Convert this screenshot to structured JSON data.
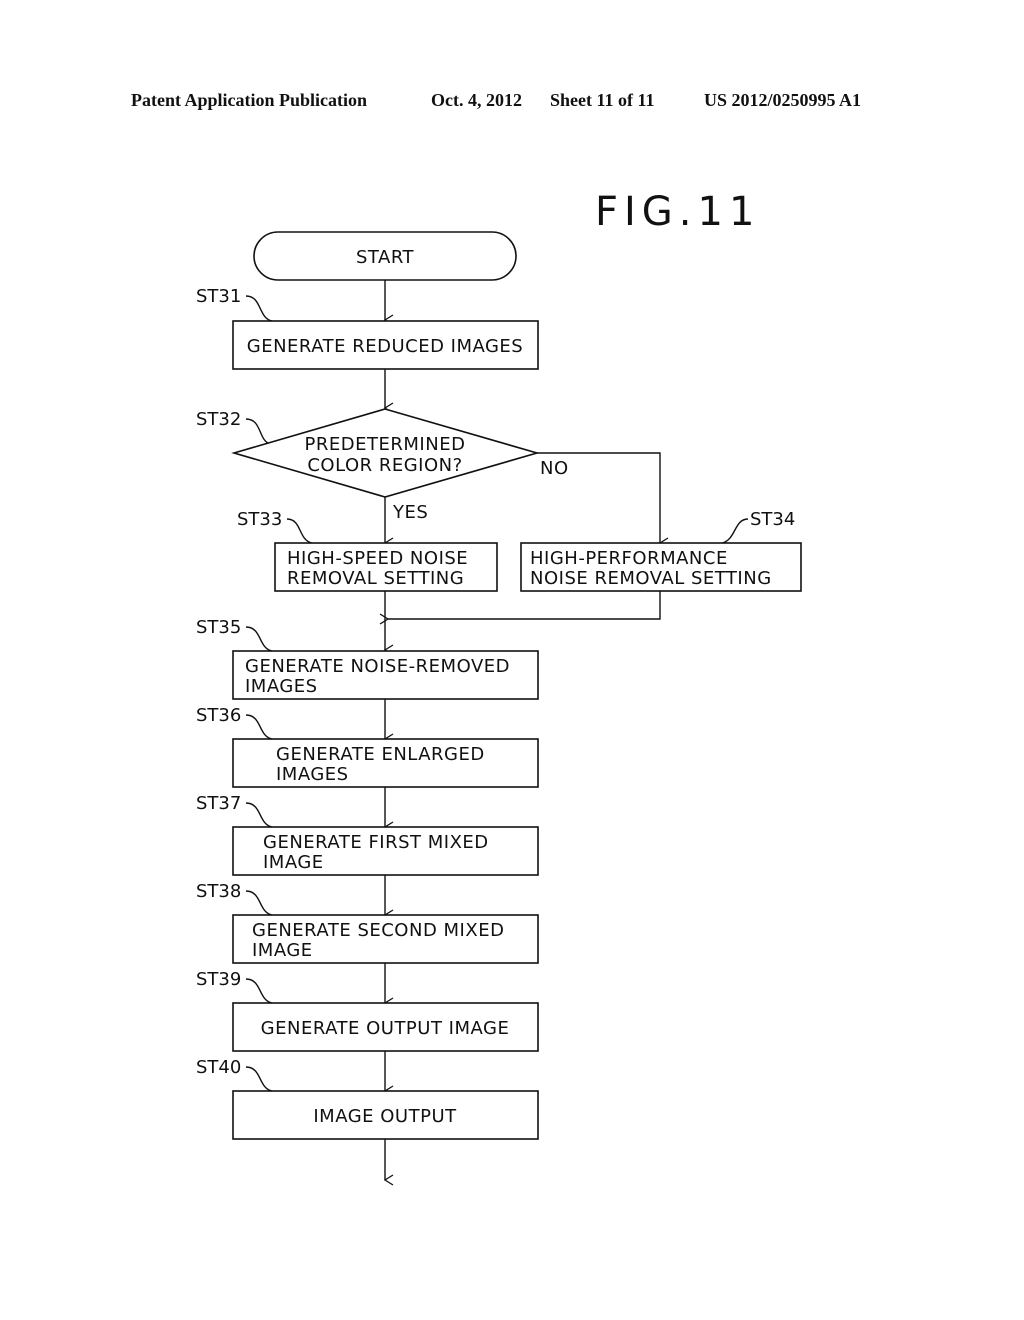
{
  "header": {
    "publication": "Patent Application Publication",
    "date": "Oct. 4, 2012",
    "sheet": "Sheet 11 of 11",
    "number": "US 2012/0250995 A1"
  },
  "figure": {
    "title": "FIG.11"
  },
  "flowchart": {
    "start": "START",
    "steps": {
      "st31": {
        "id": "ST31",
        "lines": [
          "GENERATE REDUCED IMAGES"
        ]
      },
      "st32": {
        "id": "ST32",
        "lines": [
          "PREDETERMINED",
          "COLOR REGION?"
        ],
        "yes": "YES",
        "no": "NO"
      },
      "st33": {
        "id": "ST33",
        "lines": [
          "HIGH-SPEED NOISE",
          "REMOVAL SETTING"
        ]
      },
      "st34": {
        "id": "ST34",
        "lines": [
          "HIGH-PERFORMANCE",
          "NOISE REMOVAL SETTING"
        ]
      },
      "st35": {
        "id": "ST35",
        "lines": [
          "GENERATE NOISE-REMOVED",
          "IMAGES"
        ]
      },
      "st36": {
        "id": "ST36",
        "lines": [
          "GENERATE ENLARGED",
          "IMAGES"
        ]
      },
      "st37": {
        "id": "ST37",
        "lines": [
          "GENERATE FIRST MIXED",
          "IMAGE"
        ]
      },
      "st38": {
        "id": "ST38",
        "lines": [
          "GENERATE SECOND MIXED",
          "IMAGE"
        ]
      },
      "st39": {
        "id": "ST39",
        "lines": [
          "GENERATE OUTPUT IMAGE"
        ]
      },
      "st40": {
        "id": "ST40",
        "lines": [
          "IMAGE OUTPUT"
        ]
      }
    }
  }
}
